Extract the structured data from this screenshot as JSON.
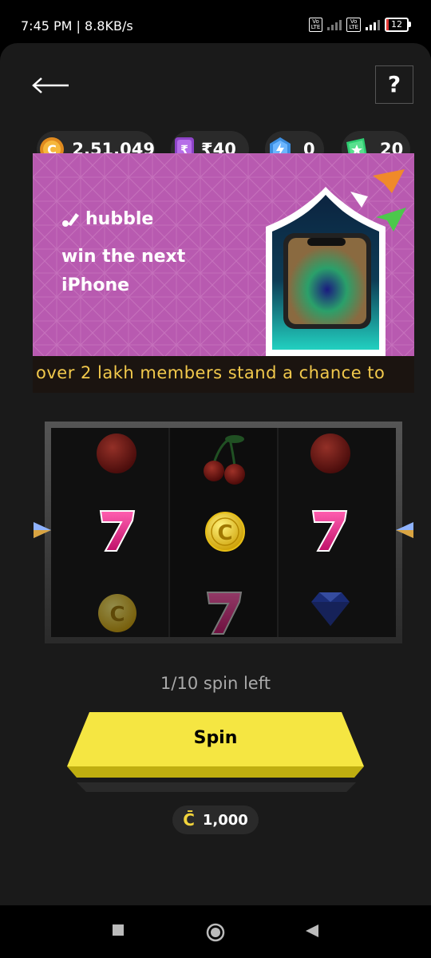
{
  "status_bar": {
    "time_speed": "7:45 PM | 8.8KB/s",
    "volte1": "Vo LTE",
    "volte2": "Vo LTE",
    "net_type": "4G",
    "battery": "12"
  },
  "header": {
    "help_label": "?"
  },
  "balances": {
    "coins": "2,51,049",
    "cash": "₹40",
    "gems": "0",
    "tickets": "20"
  },
  "banner": {
    "brand": "hubble",
    "tagline": "win the next iPhone",
    "ticker": "over 2 lakh members stand a chance to"
  },
  "slot": {
    "reels": [
      [
        "cherry",
        "seven",
        "coin"
      ],
      [
        "cherries",
        "coin",
        "seven"
      ],
      [
        "cherry",
        "seven",
        "diamond"
      ]
    ]
  },
  "spin": {
    "spins_left": "1/10 spin left",
    "button_label": "Spin",
    "cost_currency": "C̄",
    "cost_value": "1,000"
  },
  "colors": {
    "background": "#1a1a1a",
    "accent_yellow": "#f5e642",
    "banner_pink": "#b85ab0",
    "ticker_text": "#f2c94c"
  }
}
